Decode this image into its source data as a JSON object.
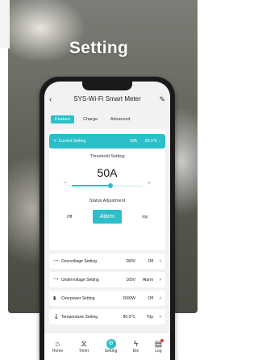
{
  "hero": {
    "title": "Setting"
  },
  "app": {
    "title": "SYS-Wi-Fi Smart Meter",
    "tabs": [
      "Feature",
      "Charge",
      "Advanced"
    ],
    "current_setting": {
      "label": "Current Setting",
      "value1": "50A",
      "value2": "80.0℃"
    },
    "threshold": {
      "title": "Threshold Setting",
      "value": "50A",
      "level": 0.55
    },
    "status": {
      "title": "Status Adjustment",
      "options": [
        "Off",
        "Alarm",
        "trip"
      ],
      "selected": "Alarm"
    },
    "rows": [
      {
        "name": "Overvoltage Setting",
        "value": "280V",
        "state": "Off"
      },
      {
        "name": "Undervoltage Setting",
        "value": "165V",
        "state": "Alarm"
      },
      {
        "name": "Overpower Setting",
        "value": "2000W",
        "state": "Off"
      },
      {
        "name": "Temperature Setting",
        "value": "80.0°C",
        "state": "Trip"
      }
    ],
    "bottom_nav": [
      "Home",
      "Timer",
      "Setting",
      "Ele",
      "Log"
    ]
  }
}
